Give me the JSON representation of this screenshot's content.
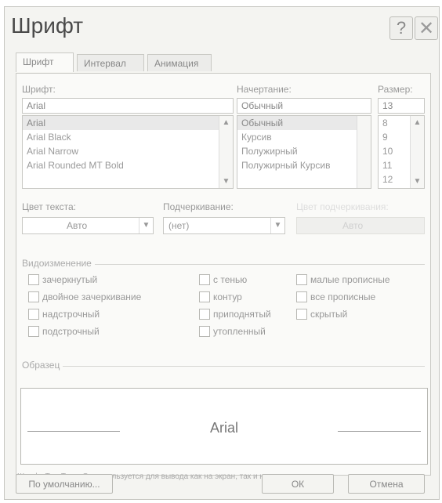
{
  "window": {
    "title": "Шрифт"
  },
  "titlebar": {
    "help_glyph": "?",
    "close_glyph": "✕"
  },
  "tabs": [
    {
      "label": "Шрифт",
      "active": true
    },
    {
      "label": "Интервал",
      "active": false
    },
    {
      "label": "Анимация",
      "active": false
    }
  ],
  "font": {
    "label": "Шрифт:",
    "value": "Arial",
    "items": [
      "Arial",
      "Arial Black",
      "Arial Narrow",
      "Arial Rounded MT Bold"
    ],
    "selected_index": 0
  },
  "style": {
    "label": "Начертание:",
    "value": "Обычный",
    "items": [
      "Обычный",
      "Курсив",
      "Полужирный",
      "Полужирный Курсив"
    ],
    "selected_index": 0
  },
  "size": {
    "label": "Размер:",
    "value": "13",
    "items": [
      "8",
      "9",
      "10",
      "11",
      "12"
    ]
  },
  "color": {
    "label": "Цвет текста:",
    "value": "Авто"
  },
  "underline": {
    "label": "Подчеркивание:",
    "value": "(нет)"
  },
  "underline_color": {
    "label": "Цвет подчеркивания:",
    "value": "Авто"
  },
  "effects": {
    "label": "Видоизменение",
    "items": [
      "зачеркнутый",
      "двойное зачеркивание",
      "надстрочный",
      "подстрочный",
      "с тенью",
      "контур",
      "приподнятый",
      "утопленный",
      "малые прописные",
      "все прописные",
      "скрытый"
    ]
  },
  "preview": {
    "label": "Образец",
    "text": "Arial",
    "note": "Шрифт TrueType. Он используется для вывода как на экран, так и на принтер."
  },
  "buttons": {
    "default": "По умолчанию...",
    "ok": "ОК",
    "cancel": "Отмена"
  },
  "scroll": {
    "up": "▲",
    "down": "▼"
  }
}
